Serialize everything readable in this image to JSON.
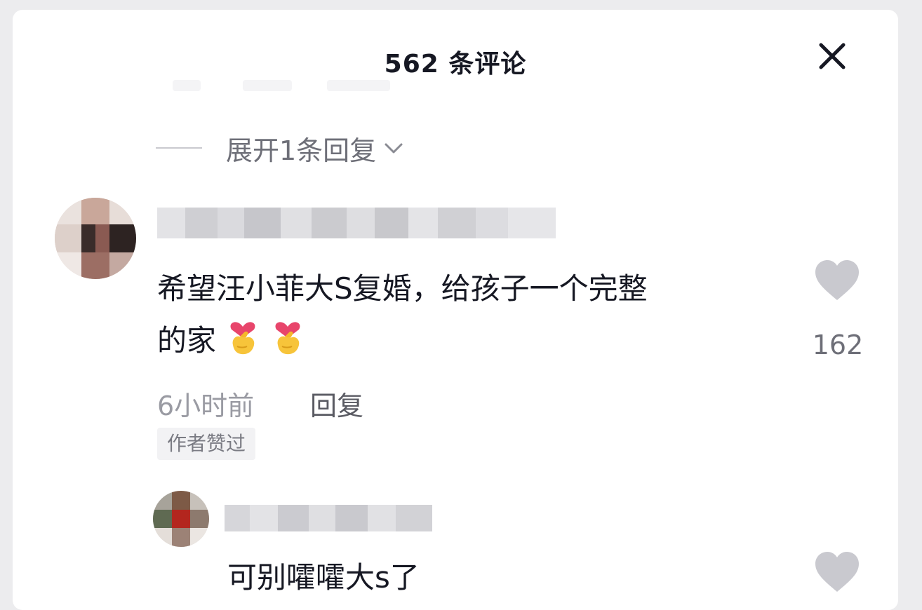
{
  "header": {
    "title": "562 条评论",
    "close_icon": "close-icon"
  },
  "thread": {
    "expand_replies_label": "展开1条回复",
    "expand_icon": "chevron-down-icon"
  },
  "comment": {
    "avatar": "avatar-pixelated",
    "text_line1": "希望汪小菲大S复婚，给孩子一个完整",
    "text_line2": "的家",
    "emoji_icons": [
      "finger-heart-emoji",
      "finger-heart-emoji"
    ],
    "time": "6小时前",
    "reply_label": "回复",
    "badge": "作者赞过",
    "like_icon": "heart-icon",
    "like_count": "162",
    "like_color": "#c9c9cf"
  },
  "reply": {
    "avatar": "avatar-pixelated",
    "text": "可别嚯嚯大s了",
    "like_icon": "heart-icon"
  }
}
